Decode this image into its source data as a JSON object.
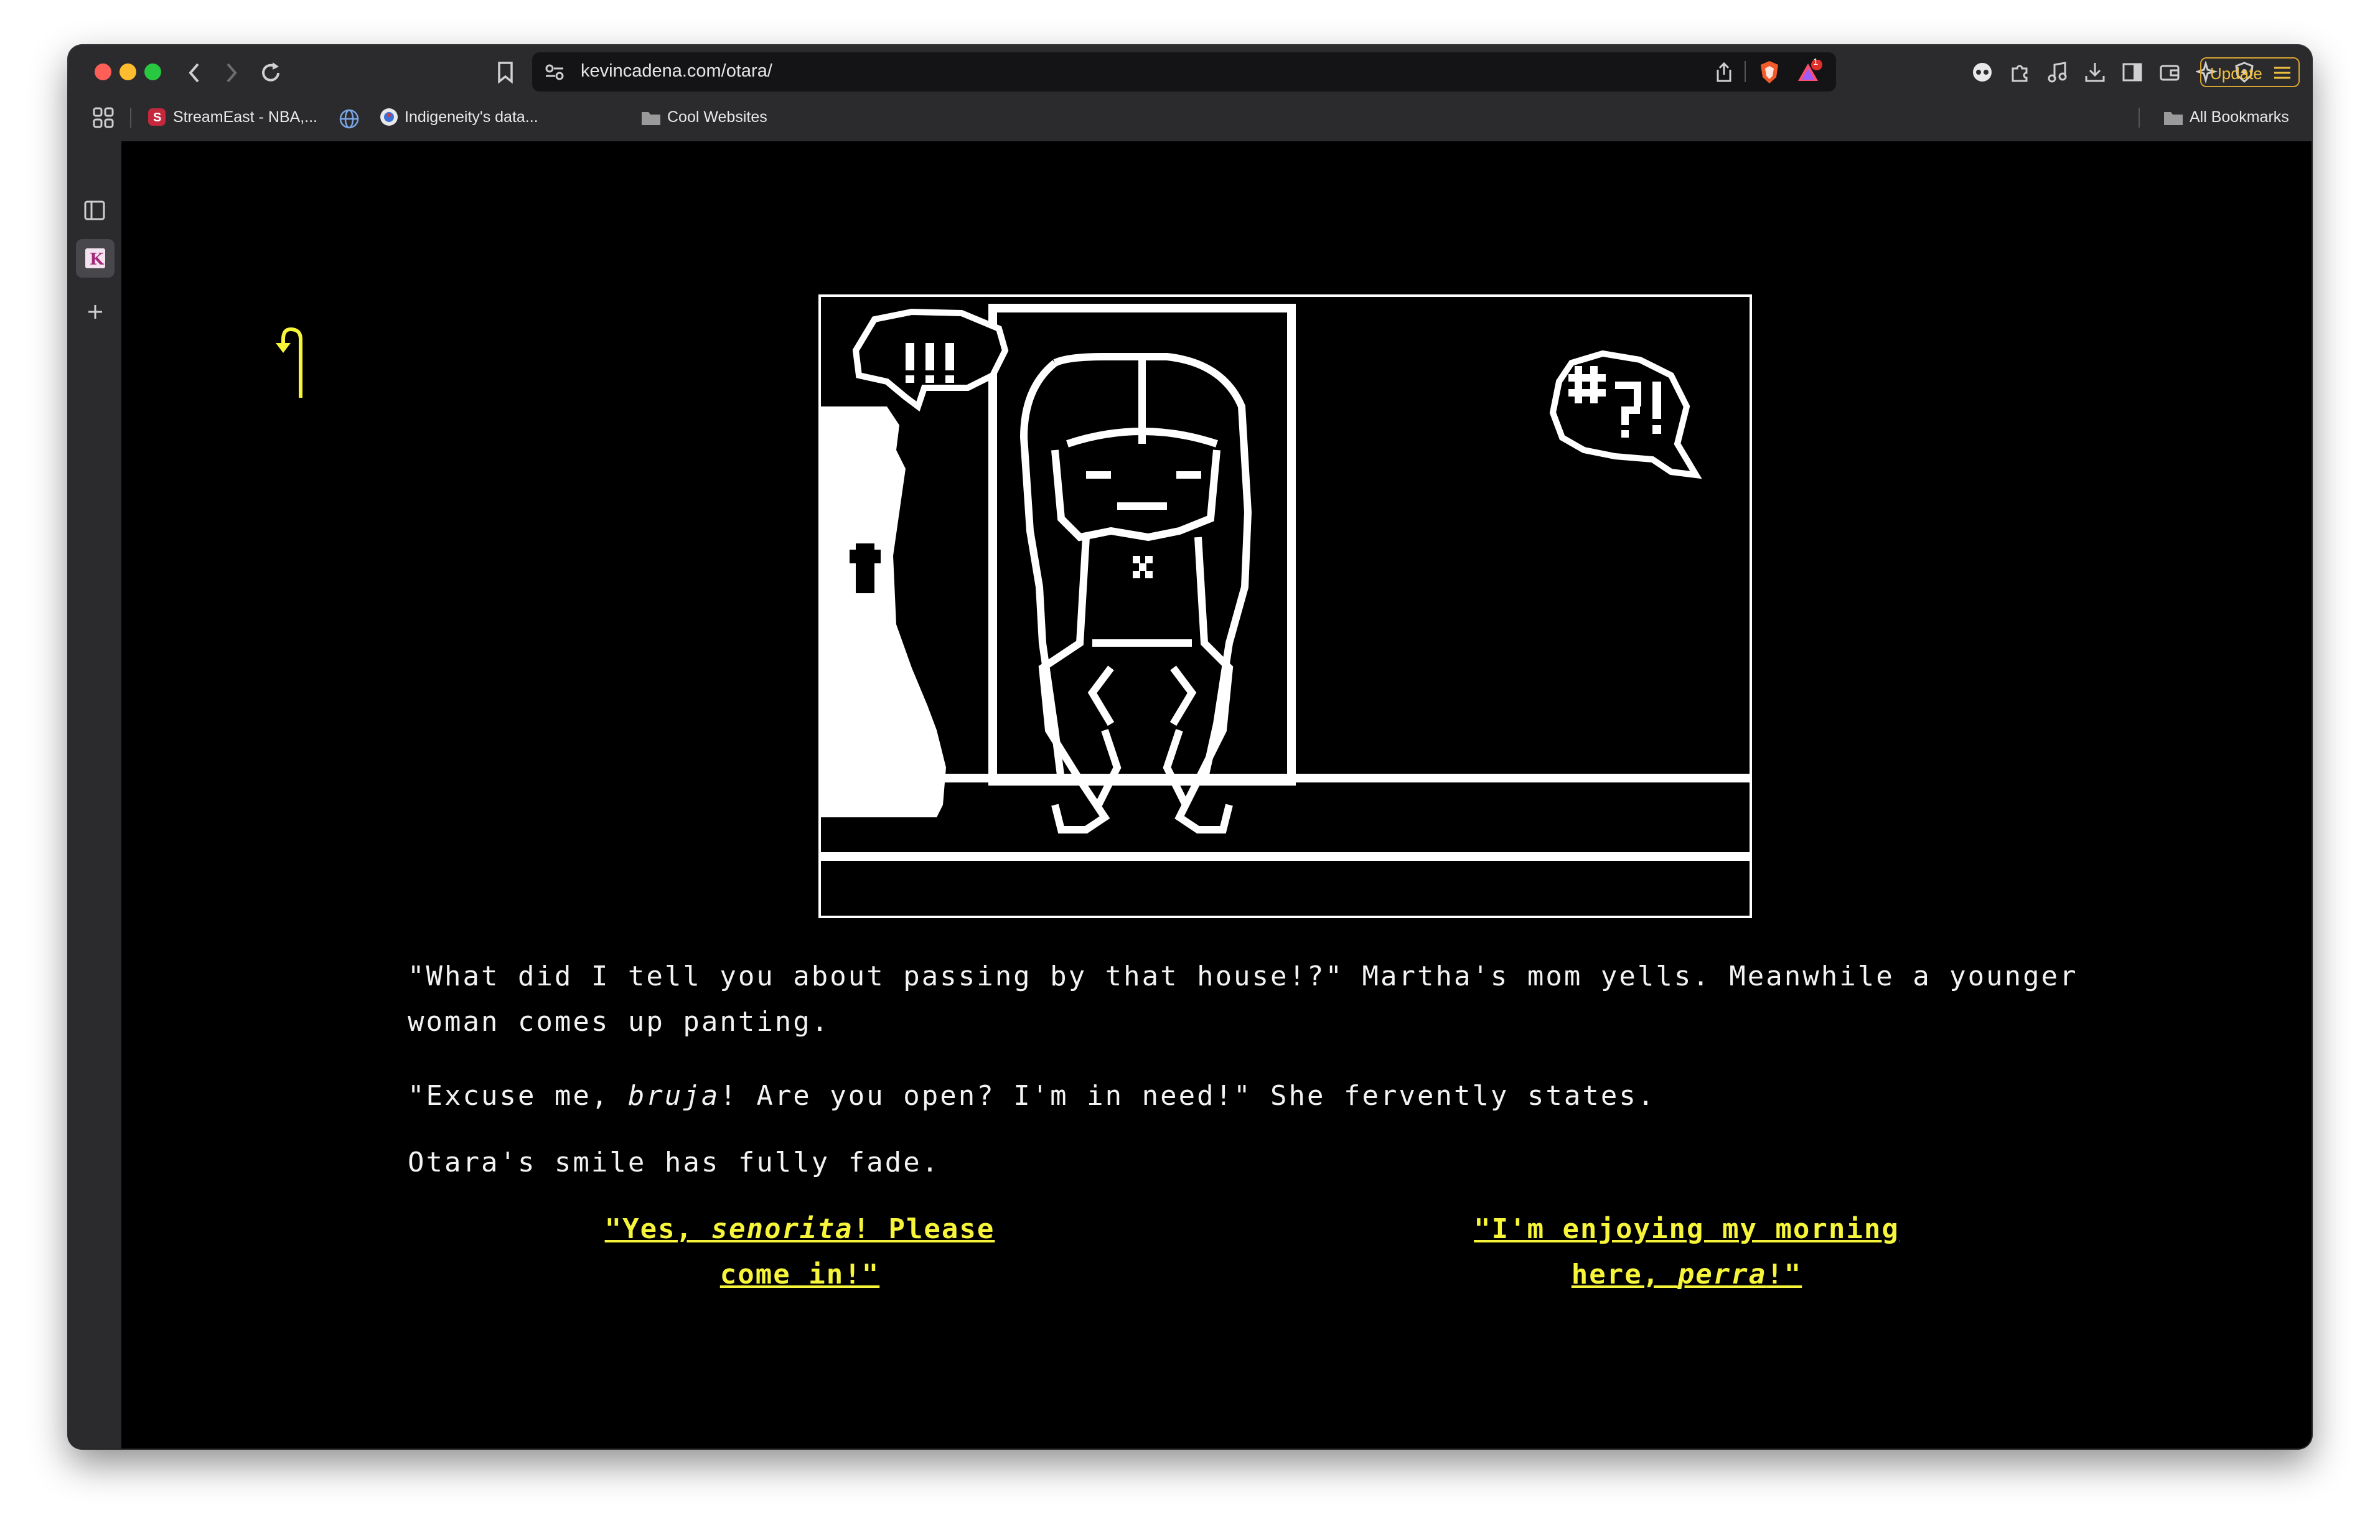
{
  "browser": {
    "url": "kevincadena.com/otara/",
    "update_label": "Update",
    "notification_count": "1",
    "bookmarks": [
      {
        "label": "StreamEast - NBA,..."
      },
      {
        "label": "Indigeneity's data..."
      },
      {
        "label": "Cool Websites"
      }
    ],
    "all_bookmarks_label": "All Bookmarks",
    "colors": {
      "toolbar": "#2b2b2e",
      "urlbar": "#141416",
      "accent": "#d9a531"
    }
  },
  "story": {
    "paragraph1": "\"What did I tell you about passing by that house!?\" Martha's mom yells. Meanwhile a younger woman comes up panting.",
    "paragraph2_before": "\"Excuse me, ",
    "paragraph2_em": "bruja",
    "paragraph2_after": "! Are you open? I'm in need!\" She fervently states.",
    "paragraph3": "Otara's smile has fully fade.",
    "illustration": {
      "left_bubble": "!!!",
      "right_bubble": "#?!"
    },
    "colors": {
      "text": "#f2f2f2",
      "choice": "#f6f53a",
      "back_arrow": "#f6f53a"
    }
  },
  "choices": [
    {
      "before": "\"Yes, ",
      "em": "senorita",
      "after": "! Please come in!\""
    },
    {
      "before": "\"I'm enjoying my morning here, ",
      "em": "perra",
      "after": "!\""
    }
  ]
}
